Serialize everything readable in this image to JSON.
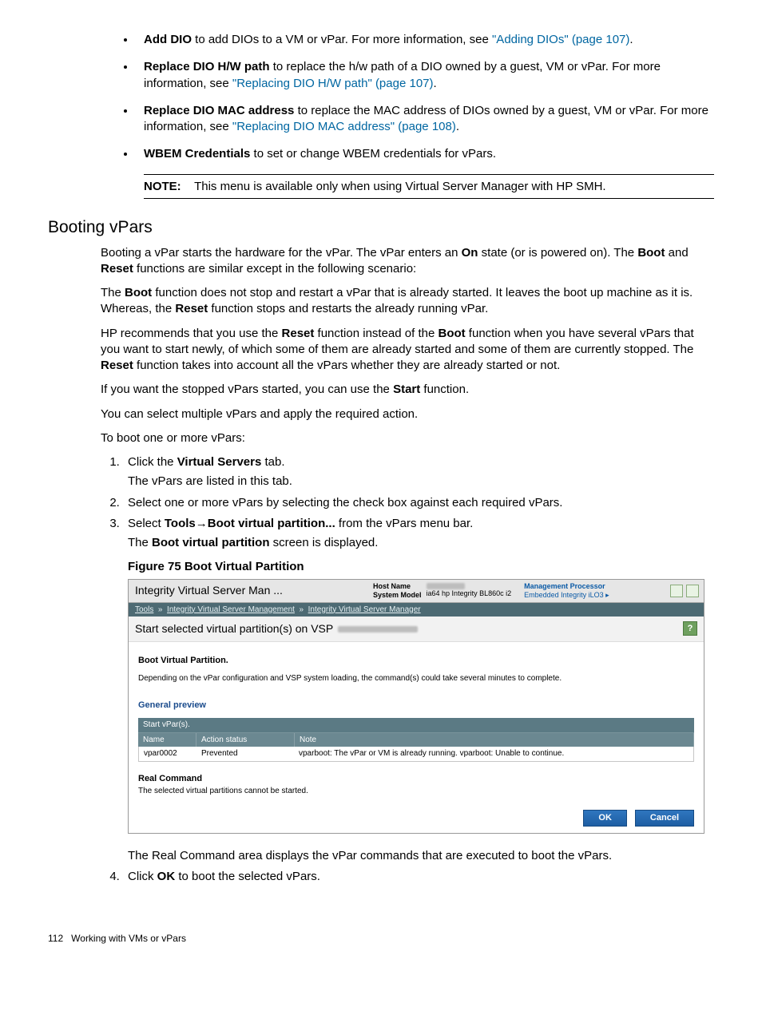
{
  "bullets": [
    {
      "term": "Add DIO",
      "desc": " to add DIOs to a VM or vPar. For more information, see ",
      "link": "\"Adding DIOs\" (page 107)",
      "after": "."
    },
    {
      "term": "Replace DIO H/W path",
      "desc": " to replace the h/w path of a DIO owned by a guest, VM or vPar. For more information, see ",
      "link": "\"Replacing DIO H/W path\" (page 107)",
      "after": "."
    },
    {
      "term": "Replace DIO MAC address",
      "desc": " to replace the MAC address of DIOs owned by a guest, VM or vPar. For more information, see ",
      "link": "\"Replacing DIO MAC address\" (page 108)",
      "after": "."
    },
    {
      "term": "WBEM Credentials",
      "desc": " to set or change WBEM credentials for vPars.",
      "link": "",
      "after": ""
    }
  ],
  "note": {
    "label": "NOTE:",
    "text": "This menu is available only when using Virtual Server Manager with HP SMH."
  },
  "section_title": "Booting vPars",
  "para1a": "Booting a vPar starts the hardware for the vPar. The vPar enters an ",
  "para1b": "On",
  "para1c": " state (or is powered on). The ",
  "para1d": "Boot",
  "para1e": " and ",
  "para1f": "Reset",
  "para1g": " functions are similar except in the following scenario:",
  "para2a": "The ",
  "para2b": "Boot",
  "para2c": " function does not stop and restart a vPar that is already started. It leaves the boot up machine as it is. Whereas, the ",
  "para2d": "Reset",
  "para2e": " function stops and restarts the already running vPar.",
  "para3a": "HP recommends that you use the ",
  "para3b": "Reset",
  "para3c": " function instead of the ",
  "para3d": "Boot",
  "para3e": " function when you have several vPars that you want to start newly, of which some of them are already started and some of them are currently stopped. The ",
  "para3f": "Reset",
  "para3g": " function takes into account all the vPars whether they are already started or not.",
  "para4a": "If you want the stopped vPars started, you can use the ",
  "para4b": "Start",
  "para4c": " function.",
  "para5": "You can select multiple vPars and apply the required action.",
  "para6": "To boot one or more vPars:",
  "steps": {
    "s1a": "Click the ",
    "s1b": "Virtual Servers",
    "s1c": " tab.",
    "s1sub": "The vPars are listed in this tab.",
    "s2": "Select one or more vPars by selecting the check box against each required vPars.",
    "s3a": "Select ",
    "s3b": "Tools",
    "s3arrow": "→",
    "s3c": "Boot virtual partition...",
    "s3d": " from the vPars menu bar.",
    "s3suba": "The ",
    "s3subb": "Boot virtual partition",
    "s3subc": " screen is displayed.",
    "s4a": "Click ",
    "s4b": "OK",
    "s4c": " to boot the selected vPars."
  },
  "figcap": "Figure 75 Boot Virtual Partition",
  "appshot": {
    "title": "Integrity Virtual Server Man ...",
    "hostname_label": "Host Name",
    "sysmodel_label": "System Model",
    "sysmodel_value": "ia64 hp Integrity BL860c i2",
    "mp_label": "Management Processor",
    "mp_value": "Embedded Integrity iLO3 ▸",
    "crumb1": "Tools",
    "crumb2": "Integrity Virtual Server Management",
    "crumb3": "Integrity Virtual Server Manager",
    "subtitle": "Start selected virtual partition(s) on VSP",
    "boot_heading": "Boot Virtual Partition.",
    "boot_note": "Depending on the vPar configuration and VSP system loading, the command(s) could take several minutes to complete.",
    "gp": "General preview",
    "tbl_caption": "Start vPar(s).",
    "col_name": "Name",
    "col_status": "Action status",
    "col_note": "Note",
    "row_name": "vpar0002",
    "row_status": "Prevented",
    "row_note": "vparboot: The vPar or VM is already running. vparboot: Unable to continue.",
    "real_cmd": "Real Command",
    "real_cmd_note": "The selected virtual partitions cannot be started.",
    "ok": "OK",
    "cancel": "Cancel"
  },
  "after_fig": "The Real Command area displays the vPar commands that are executed to boot the vPars.",
  "footer_page": "112",
  "footer_text": "Working with VMs or vPars"
}
